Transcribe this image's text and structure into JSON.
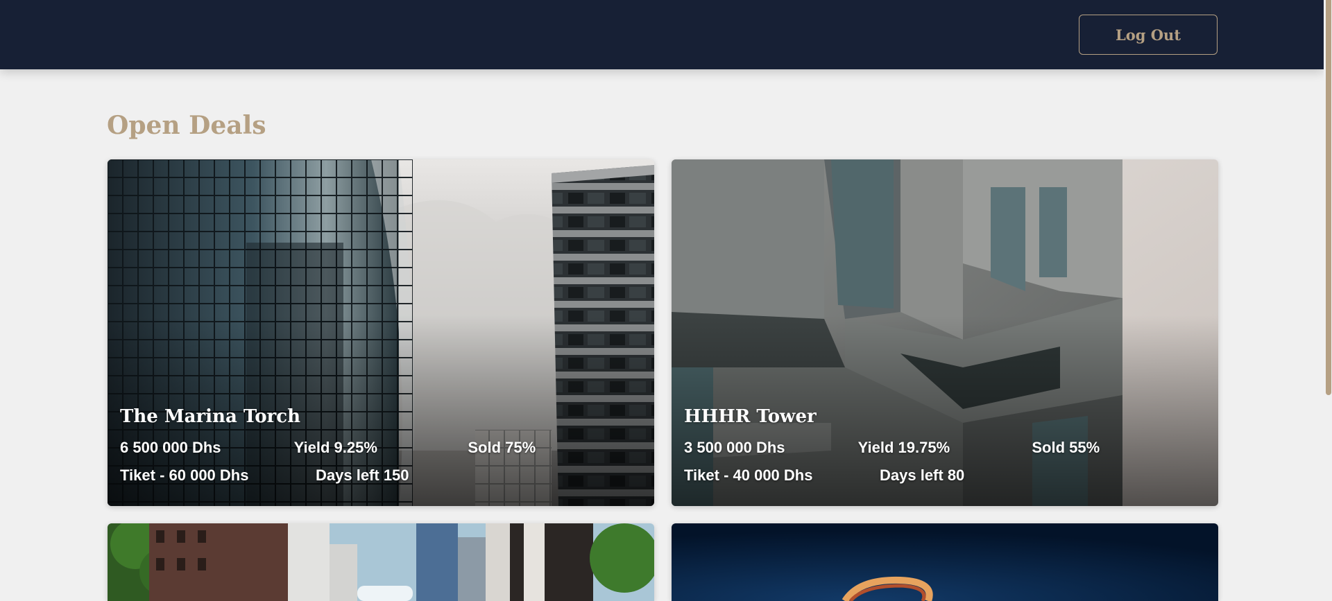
{
  "header": {
    "logout_label": "Log Out"
  },
  "main": {
    "title": "Open Deals",
    "deals": [
      {
        "name": "The Marina Torch",
        "price": "6 500 000 Dhs",
        "yield": "Yield 9.25%",
        "sold": "Sold 75%",
        "ticket": "Tiket - 60 000 Dhs",
        "days_left": "Days left 150"
      },
      {
        "name": "HHHR Tower",
        "price": "3 500 000 Dhs",
        "yield": "Yield 19.75%",
        "sold": "Sold 55%",
        "ticket": "Tiket - 40 000 Dhs",
        "days_left": "Days left 80"
      },
      {},
      {}
    ]
  },
  "colors": {
    "header_bg": "#172035",
    "accent": "#b5a083",
    "page_bg": "#f0f0f0"
  }
}
